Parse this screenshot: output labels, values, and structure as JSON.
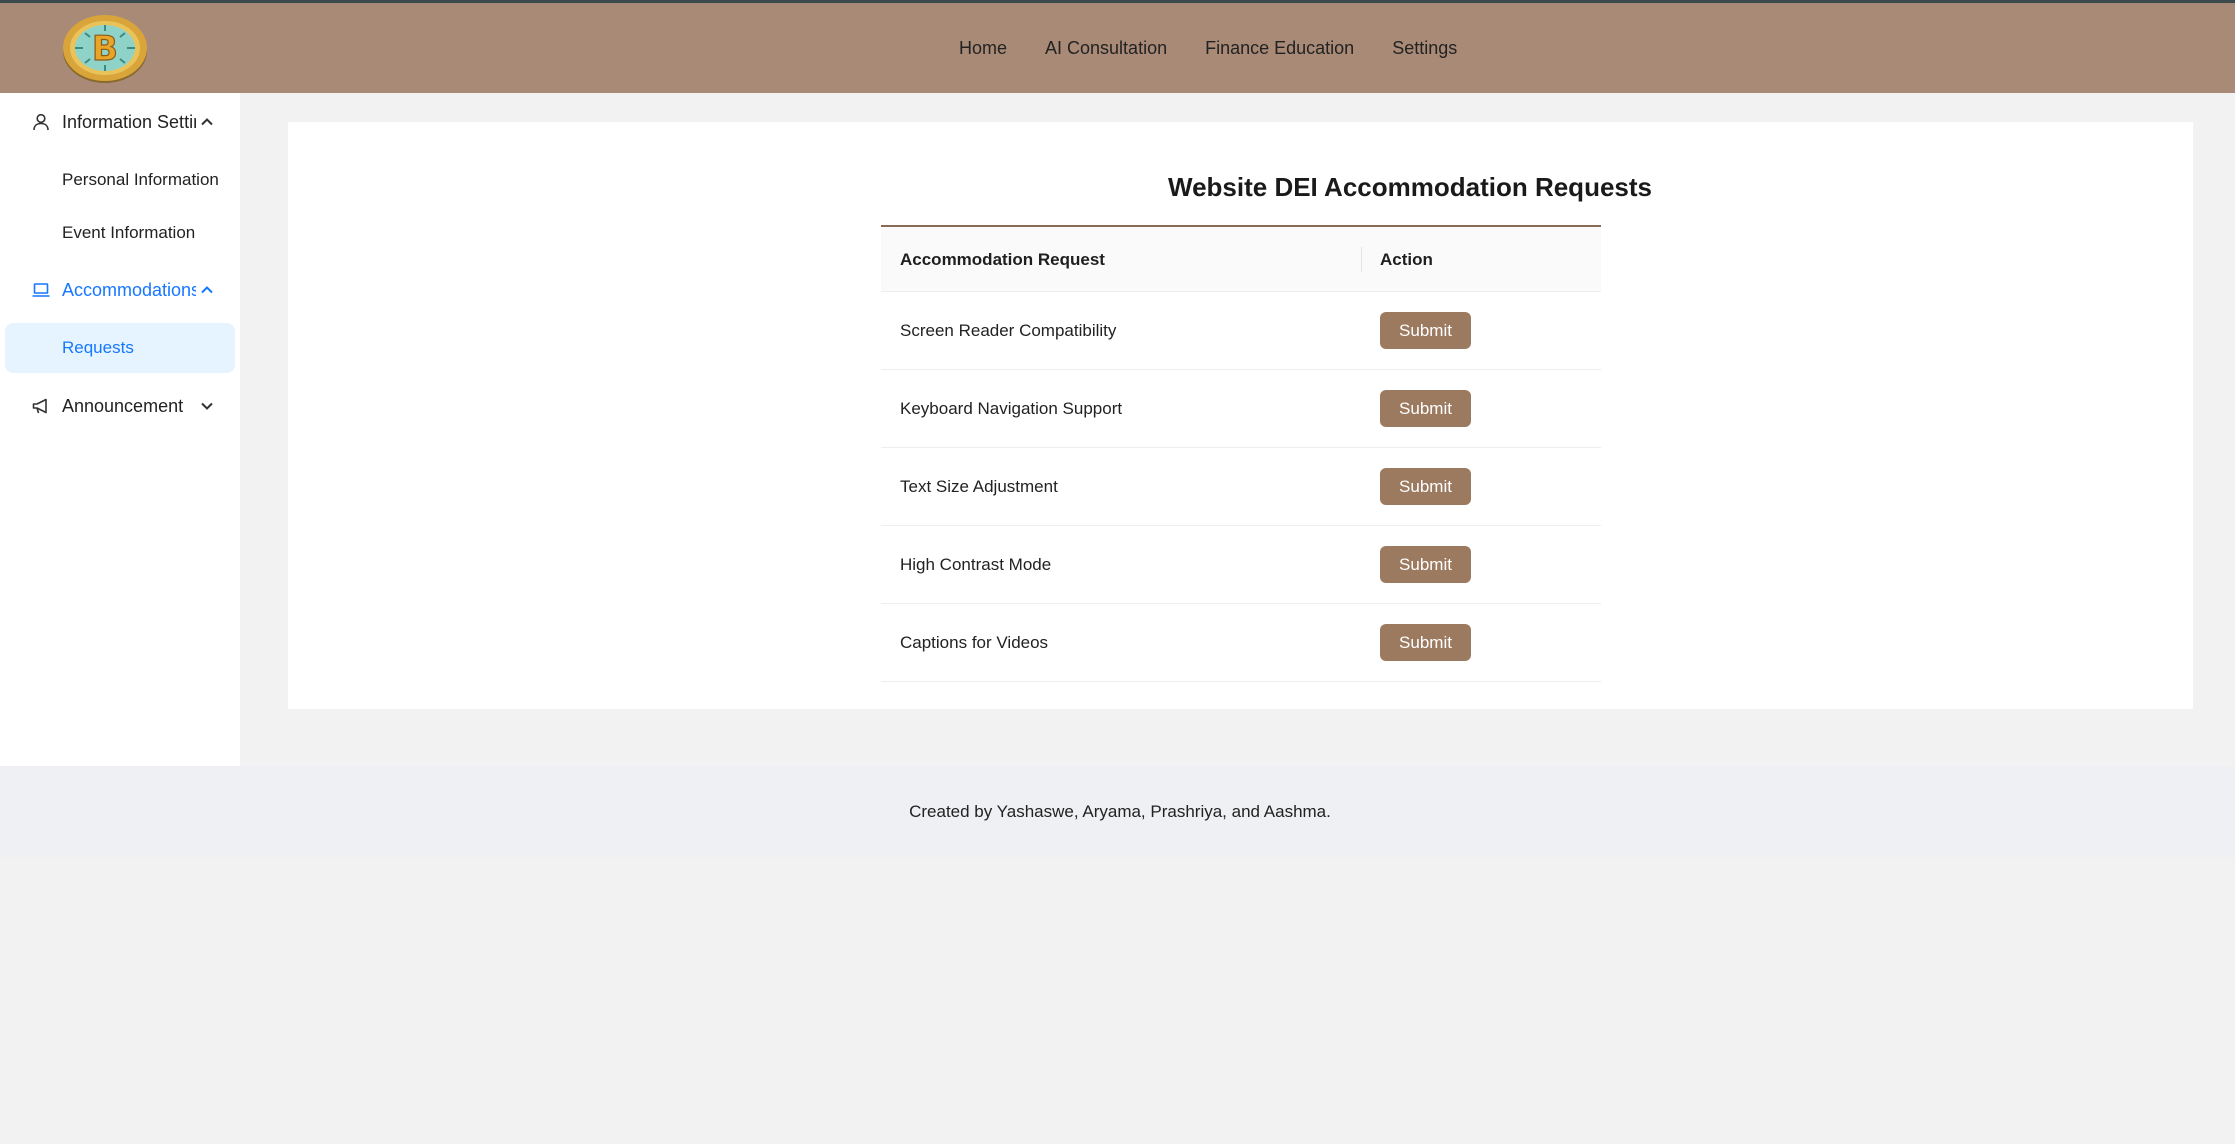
{
  "header": {
    "logo": "bitcoin-logo",
    "nav": [
      "Home",
      "AI Consultation",
      "Finance Education",
      "Settings"
    ]
  },
  "sidebar": {
    "groups": [
      {
        "label": "Information Settings",
        "icon": "user-icon",
        "expanded": true,
        "items": [
          "Personal Information",
          "Event Information"
        ]
      },
      {
        "label": "Accommodations",
        "icon": "laptop-icon",
        "expanded": true,
        "active": true,
        "items": [
          "Requests"
        ]
      },
      {
        "label": "Announcement",
        "icon": "megaphone-icon",
        "expanded": false,
        "items": []
      }
    ],
    "selected_item": "Requests"
  },
  "main": {
    "title": "Website DEI Accommodation Requests",
    "table": {
      "columns": [
        "Accommodation Request",
        "Action"
      ],
      "rows": [
        {
          "request": "Screen Reader Compatibility",
          "action": "Submit"
        },
        {
          "request": "Keyboard Navigation Support",
          "action": "Submit"
        },
        {
          "request": "Text Size Adjustment",
          "action": "Submit"
        },
        {
          "request": "High Contrast Mode",
          "action": "Submit"
        },
        {
          "request": "Captions for Videos",
          "action": "Submit"
        }
      ]
    }
  },
  "footer": {
    "text": "Created by Yashaswe, Aryama, Prashriya, and Aashma."
  },
  "colors": {
    "header_bg": "#a88a77",
    "button_bg": "#9c7a60",
    "accent": "#1677ff",
    "selected_bg": "#e6f4ff"
  }
}
